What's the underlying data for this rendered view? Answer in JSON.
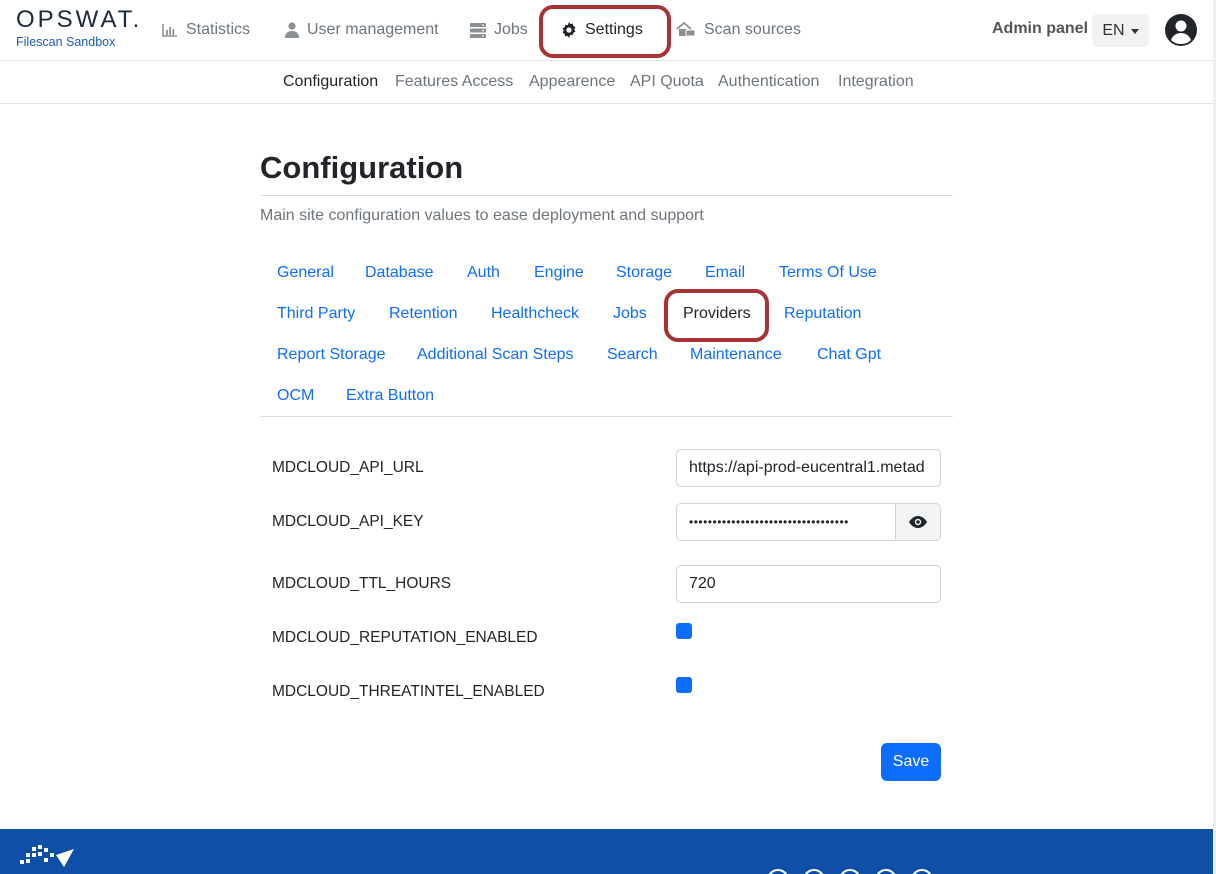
{
  "brand": {
    "name": "OPSWAT.",
    "product": "Filescan Sandbox"
  },
  "nav": {
    "statistics": "Statistics",
    "user_management": "User management",
    "jobs": "Jobs",
    "settings": "Settings",
    "scan_sources": "Scan sources",
    "admin_panel": "Admin panel",
    "language": "EN"
  },
  "subnav": [
    "Configuration",
    "Features Access",
    "Appearence",
    "API Quota",
    "Authentication",
    "Integration"
  ],
  "page": {
    "title": "Configuration",
    "description": "Main site configuration values to ease deployment and support"
  },
  "tabs": [
    "General",
    "Database",
    "Auth",
    "Engine",
    "Storage",
    "Email",
    "Terms Of Use",
    "Third Party",
    "Retention",
    "Healthcheck",
    "Jobs",
    "Providers",
    "Reputation",
    "Report Storage",
    "Additional Scan Steps",
    "Search",
    "Maintenance",
    "Chat Gpt",
    "OCM",
    "Extra Button"
  ],
  "active_tab": "Providers",
  "fields": {
    "api_url": {
      "label": "MDCLOUD_API_URL",
      "value": "https://api-prod-eucentral1.metad"
    },
    "api_key": {
      "label": "MDCLOUD_API_KEY",
      "value": "••••••••••••••••••••••••••••••••••"
    },
    "ttl_hours": {
      "label": "MDCLOUD_TTL_HOURS",
      "value": "720"
    },
    "reputation_enabled": {
      "label": "MDCLOUD_REPUTATION_ENABLED",
      "checked": true
    },
    "threatintel_enabled": {
      "label": "MDCLOUD_THREATINTEL_ENABLED",
      "checked": true
    }
  },
  "save_label": "Save",
  "colors": {
    "accent": "#0d6efd",
    "highlight": "#a83236",
    "footer": "#0f4fa8"
  }
}
